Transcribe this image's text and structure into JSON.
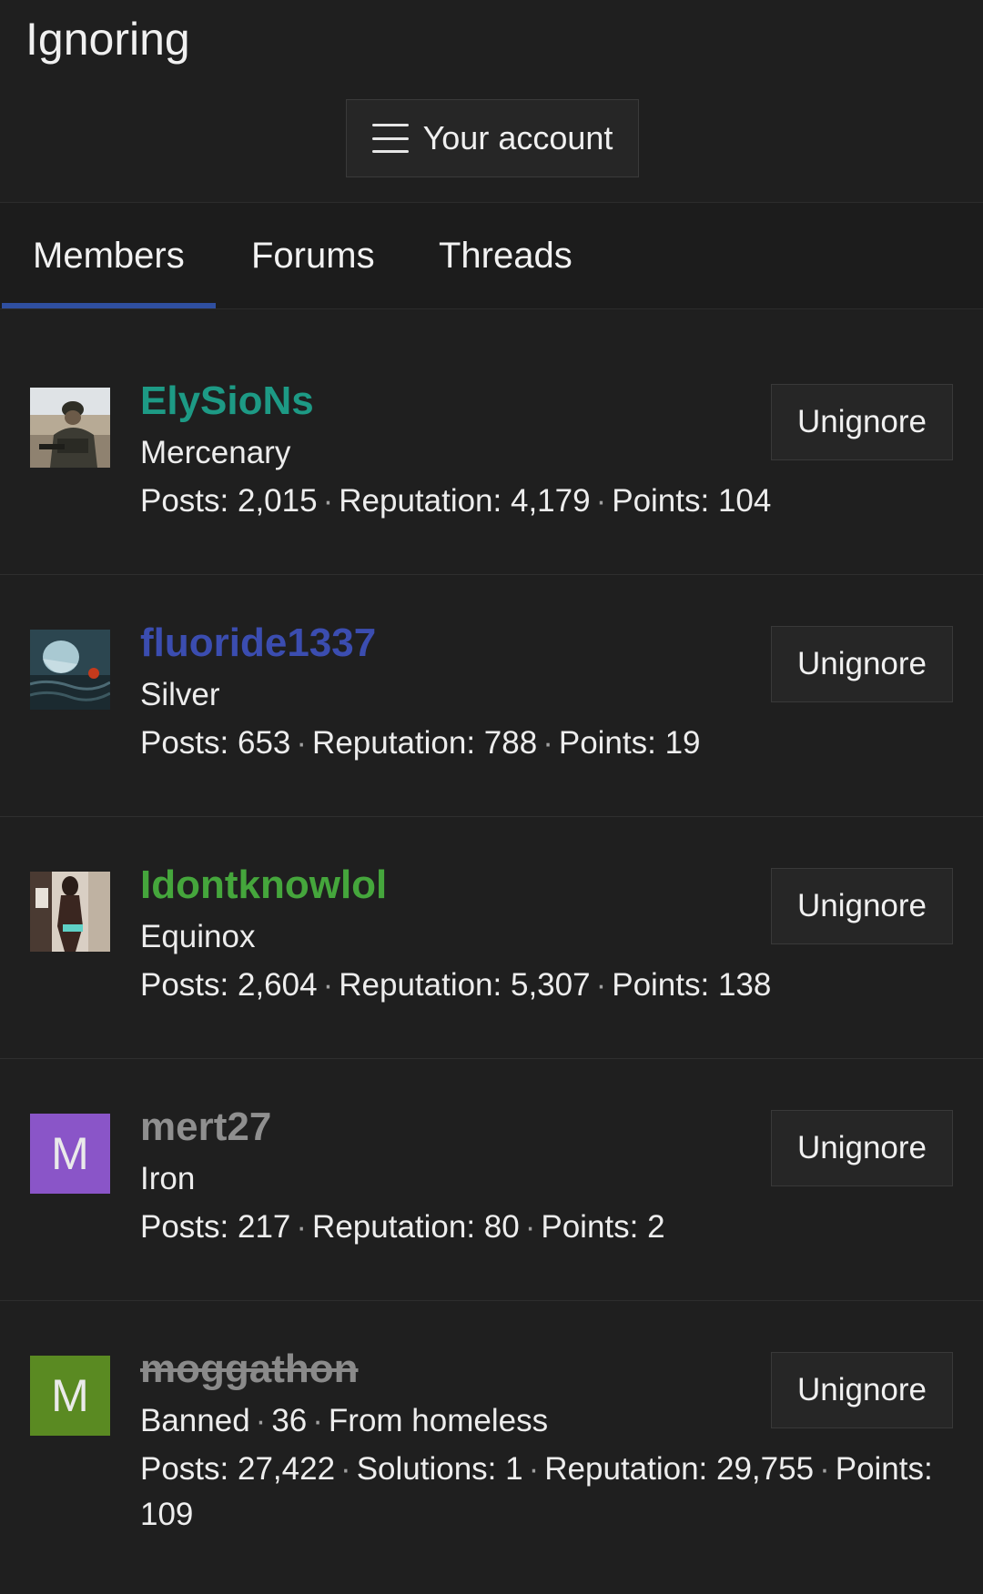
{
  "page": {
    "title": "Ignoring"
  },
  "account_menu": {
    "label": "Your account"
  },
  "tabs": [
    {
      "label": "Members",
      "active": true
    },
    {
      "label": "Forums",
      "active": false
    },
    {
      "label": "Threads",
      "active": false
    }
  ],
  "members": [
    {
      "username": "ElySioNs",
      "name_color": "#1d9a85",
      "struck": false,
      "avatar": {
        "type": "image",
        "icon": "soldier-photo"
      },
      "title_parts": [
        "Mercenary"
      ],
      "stats": [
        "Posts: 2,015",
        "Reputation: 4,179",
        "Points: 104"
      ],
      "button": "Unignore"
    },
    {
      "username": "fluoride1337",
      "name_color": "#3b4db0",
      "struck": false,
      "avatar": {
        "type": "image",
        "icon": "water-figure-photo"
      },
      "title_parts": [
        "Silver"
      ],
      "stats": [
        "Posts: 653",
        "Reputation: 788",
        "Points: 19"
      ],
      "button": "Unignore"
    },
    {
      "username": "Idontknowlol",
      "name_color": "#45a63c",
      "struck": false,
      "avatar": {
        "type": "image",
        "icon": "person-photo"
      },
      "title_parts": [
        "Equinox"
      ],
      "stats": [
        "Posts: 2,604",
        "Reputation: 5,307",
        "Points: 138"
      ],
      "button": "Unignore"
    },
    {
      "username": "mert27",
      "name_color": "#8f8f8f",
      "struck": false,
      "avatar": {
        "type": "letter",
        "letter": "M",
        "bg": "#8a55c8"
      },
      "title_parts": [
        "Iron"
      ],
      "stats": [
        "Posts: 217",
        "Reputation: 80",
        "Points: 2"
      ],
      "button": "Unignore"
    },
    {
      "username": "moggathon",
      "name_color": "#8a8a8a",
      "struck": true,
      "avatar": {
        "type": "letter",
        "letter": "M",
        "bg": "#5a8a22"
      },
      "title_parts": [
        "Banned",
        "36",
        "From homeless"
      ],
      "stats": [
        "Posts: 27,422",
        "Solutions: 1",
        "Reputation: 29,755",
        "Points: 109"
      ],
      "button": "Unignore"
    }
  ]
}
